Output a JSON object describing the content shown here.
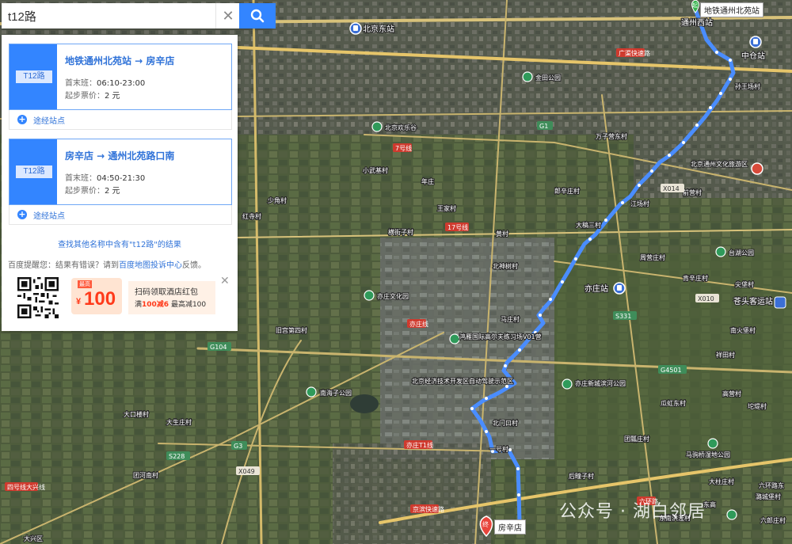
{
  "search": {
    "query": "t12路"
  },
  "routes": [
    {
      "badge": "T12路",
      "title": "地铁通州北苑站 → 房辛店",
      "first_last_label": "首末班：",
      "first_last": "06:10-23:00",
      "fare_label": "起步票价：",
      "fare": "2 元",
      "stops_label": "途经站点"
    },
    {
      "badge": "T12路",
      "title": "房辛店 → 通州北苑路口南",
      "first_last_label": "首末班：",
      "first_last": "04:50-21:30",
      "fare_label": "起步票价：",
      "fare": "2 元",
      "stops_label": "途经站点"
    }
  ],
  "more_link": "查找其他名称中含有\"t12路\"的结果",
  "tip": {
    "prefix": "百度提醒您：结果有错误？请到",
    "link": "百度地图投诉中心",
    "suffix": "反馈。"
  },
  "ad": {
    "tag": "最高",
    "currency": "¥",
    "amount": "100",
    "line1": "扫码领取酒店红包",
    "line2_a": "满",
    "line2_b": "100减6",
    "line2_c": " 最高减100"
  },
  "markers": {
    "start_label": "地铁通州北苑站",
    "start_glyph": "起",
    "end_label": "房辛店",
    "end_glyph": "终"
  },
  "watermark": "公众号 · 湖白邻居",
  "map_labels": {
    "stations": [
      "北京东站",
      "通州西站",
      "中仓站",
      "亦庄站",
      "苍头客运站"
    ],
    "places": [
      "金田公园",
      "北京欢乐谷",
      "孙王场村",
      "万子营东村",
      "北京通州文化旅游区",
      "前营村",
      "江场村",
      "小武基村",
      "年庄",
      "郎辛庄村",
      "大稿三村",
      "王家村",
      "横街子村",
      "黄村",
      "周营庄村",
      "台湖公园",
      "少角村",
      "红寺村",
      "北神树村",
      "肯辛庄村",
      "尖垡村",
      "亦庄文化园",
      "马庄村",
      "南火堡村",
      "旧宫第四村",
      "鸿雁国际高尔夫练习场V01营",
      "亦庄新城滨河公园",
      "祥田村",
      "南海子公园",
      "北京经济技术开发区自动驾驶示范区",
      "高营村",
      "坨堤村",
      "瓜虹东村",
      "大口楼村",
      "大生庄村",
      "北门口村",
      "团瓢庄村",
      "马驹桥湿地公园",
      "一号村",
      "团河南村",
      "后疃子村",
      "大柱庄村",
      "六环路东",
      "东高",
      "潞城堡村",
      "东南洪洼村",
      "六郎庄村",
      "大兴区"
    ],
    "roads": [
      "7号线",
      "17号线",
      "X014",
      "X010",
      "S331",
      "G4501",
      "G104",
      "S228",
      "G3",
      "X049",
      "亦庄T1线",
      "亦庄线",
      "京滨快速路",
      "四号线大兴线",
      "广渠快速路",
      "六环路",
      "G1"
    ]
  },
  "icons": {
    "search": "search-icon",
    "clear": "close-icon",
    "plus": "plus-icon"
  },
  "colors": {
    "accent": "#3385ff",
    "route_line": "#4a8dff",
    "coupon": "#ff3a1a"
  }
}
